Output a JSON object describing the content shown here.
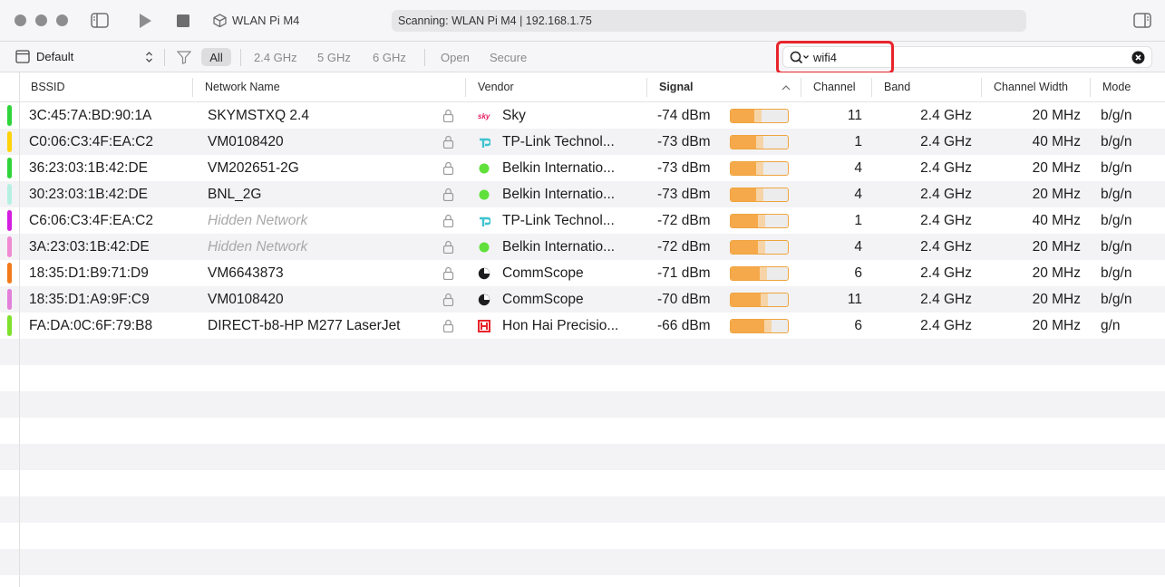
{
  "window": {
    "device_name": "WLAN Pi M4",
    "status": "Scanning: WLAN Pi M4 | 192.168.1.75"
  },
  "toolbar": {
    "profile": "Default",
    "filters": [
      "All",
      "2.4 GHz",
      "5 GHz",
      "6 GHz"
    ],
    "security_filters": [
      "Open",
      "Secure"
    ],
    "active_filter": "All"
  },
  "search": {
    "value": "wifi4"
  },
  "table": {
    "columns": [
      "BSSID",
      "Network Name",
      "Vendor",
      "Signal",
      "Channel",
      "Band",
      "Channel Width",
      "Mode"
    ],
    "sort_column": "Signal",
    "rows": [
      {
        "color": "#2fd43a",
        "bssid": "3C:45:7A:BD:90:1A",
        "name": "SKYMSTXQ 2.4",
        "hidden": false,
        "vendor_icon": "sky-logo-icon",
        "vendor": "Sky",
        "signal": "-74 dBm",
        "signal_level": 0.42,
        "channel": "11",
        "band": "2.4 GHz",
        "width": "20 MHz",
        "mode": "b/g/n"
      },
      {
        "color": "#ffd20a",
        "bssid": "C0:06:C3:4F:EA:C2",
        "name": "VM0108420",
        "hidden": false,
        "vendor_icon": "tp-link-logo-icon",
        "vendor": "TP-Link Technol...",
        "signal": "-73 dBm",
        "signal_level": 0.45,
        "channel": "1",
        "band": "2.4 GHz",
        "width": "40 MHz",
        "mode": "b/g/n"
      },
      {
        "color": "#2fd43a",
        "bssid": "36:23:03:1B:42:DE",
        "name": "VM202651-2G",
        "hidden": false,
        "vendor_icon": "green-dot-icon",
        "vendor": "Belkin Internatio...",
        "signal": "-73 dBm",
        "signal_level": 0.45,
        "channel": "4",
        "band": "2.4 GHz",
        "width": "20 MHz",
        "mode": "b/g/n"
      },
      {
        "color": "#b6f0e3",
        "bssid": "30:23:03:1B:42:DE",
        "name": "BNL_2G",
        "hidden": false,
        "vendor_icon": "green-dot-icon",
        "vendor": "Belkin Internatio...",
        "signal": "-73 dBm",
        "signal_level": 0.45,
        "channel": "4",
        "band": "2.4 GHz",
        "width": "20 MHz",
        "mode": "b/g/n"
      },
      {
        "color": "#d41ee0",
        "bssid": "C6:06:C3:4F:EA:C2",
        "name": "Hidden Network",
        "hidden": true,
        "vendor_icon": "tp-link-logo-icon",
        "vendor": "TP-Link Technol...",
        "signal": "-72 dBm",
        "signal_level": 0.48,
        "channel": "1",
        "band": "2.4 GHz",
        "width": "40 MHz",
        "mode": "b/g/n"
      },
      {
        "color": "#f08ad2",
        "bssid": "3A:23:03:1B:42:DE",
        "name": "Hidden Network",
        "hidden": true,
        "vendor_icon": "green-dot-icon",
        "vendor": "Belkin Internatio...",
        "signal": "-72 dBm",
        "signal_level": 0.48,
        "channel": "4",
        "band": "2.4 GHz",
        "width": "20 MHz",
        "mode": "b/g/n"
      },
      {
        "color": "#f27a1a",
        "bssid": "18:35:D1:B9:71:D9",
        "name": "VM6643873",
        "hidden": false,
        "vendor_icon": "commscope-logo-icon",
        "vendor": "CommScope",
        "signal": "-71 dBm",
        "signal_level": 0.5,
        "channel": "6",
        "band": "2.4 GHz",
        "width": "20 MHz",
        "mode": "b/g/n"
      },
      {
        "color": "#e27fd9",
        "bssid": "18:35:D1:A9:9F:C9",
        "name": "VM0108420",
        "hidden": false,
        "vendor_icon": "commscope-logo-icon",
        "vendor": "CommScope",
        "signal": "-70 dBm",
        "signal_level": 0.52,
        "channel": "11",
        "band": "2.4 GHz",
        "width": "20 MHz",
        "mode": "b/g/n"
      },
      {
        "color": "#7fe12c",
        "bssid": "FA:DA:0C:6F:79:B8",
        "name": "DIRECT-b8-HP M277 LaserJet",
        "hidden": false,
        "vendor_icon": "hon-hai-logo-icon",
        "vendor": "Hon Hai Precisio...",
        "signal": "-66 dBm",
        "signal_level": 0.58,
        "channel": "6",
        "band": "2.4 GHz",
        "width": "20 MHz",
        "mode": "g/n"
      }
    ]
  }
}
